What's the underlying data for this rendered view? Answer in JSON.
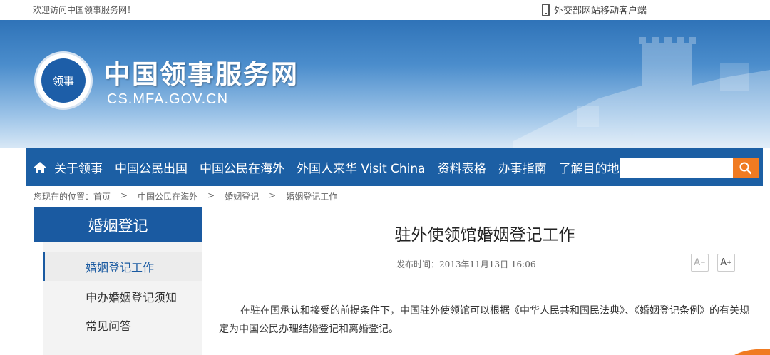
{
  "topbar": {
    "welcome": "欢迎访问中国领事服务网！",
    "mobile_link": "外交部网站移动客户端"
  },
  "banner": {
    "title": "中国领事服务网",
    "domain": "CS.MFA.GOV.CN",
    "logo_text": "领事"
  },
  "nav": {
    "items": [
      "关于领事",
      "中国公民出国",
      "中国公民在海外",
      "外国人来华 Visit China",
      "资料表格",
      "办事指南",
      "了解目的地"
    ],
    "search_placeholder": ""
  },
  "breadcrumb": {
    "prefix": "您现在的位置：首页",
    "items": [
      "中国公民在海外",
      "婚姻登记",
      "婚姻登记工作"
    ],
    "separator": ">"
  },
  "sidebar": {
    "heading": "婚姻登记",
    "items": [
      {
        "label": "婚姻登记工作",
        "active": true
      },
      {
        "label": "申办婚姻登记须知",
        "active": false
      },
      {
        "label": "常见问答",
        "active": false
      }
    ]
  },
  "article": {
    "title": "驻外使领馆婚姻登记工作",
    "pubdate": "发布时间：2013年11月13日  16:06",
    "font_minus": "A",
    "font_plus": "A",
    "paragraph": "在驻在国承认和接受的前提条件下，中国驻外使领馆可以根据《中华人民共和国民法典》、《婚姻登记条例》的有关规定为中国公民办理结婚登记和离婚登记。"
  },
  "colors": {
    "nav_bg": "#1c5fa4",
    "search_button": "#f07b22",
    "banner_top": "#2f73b8"
  }
}
